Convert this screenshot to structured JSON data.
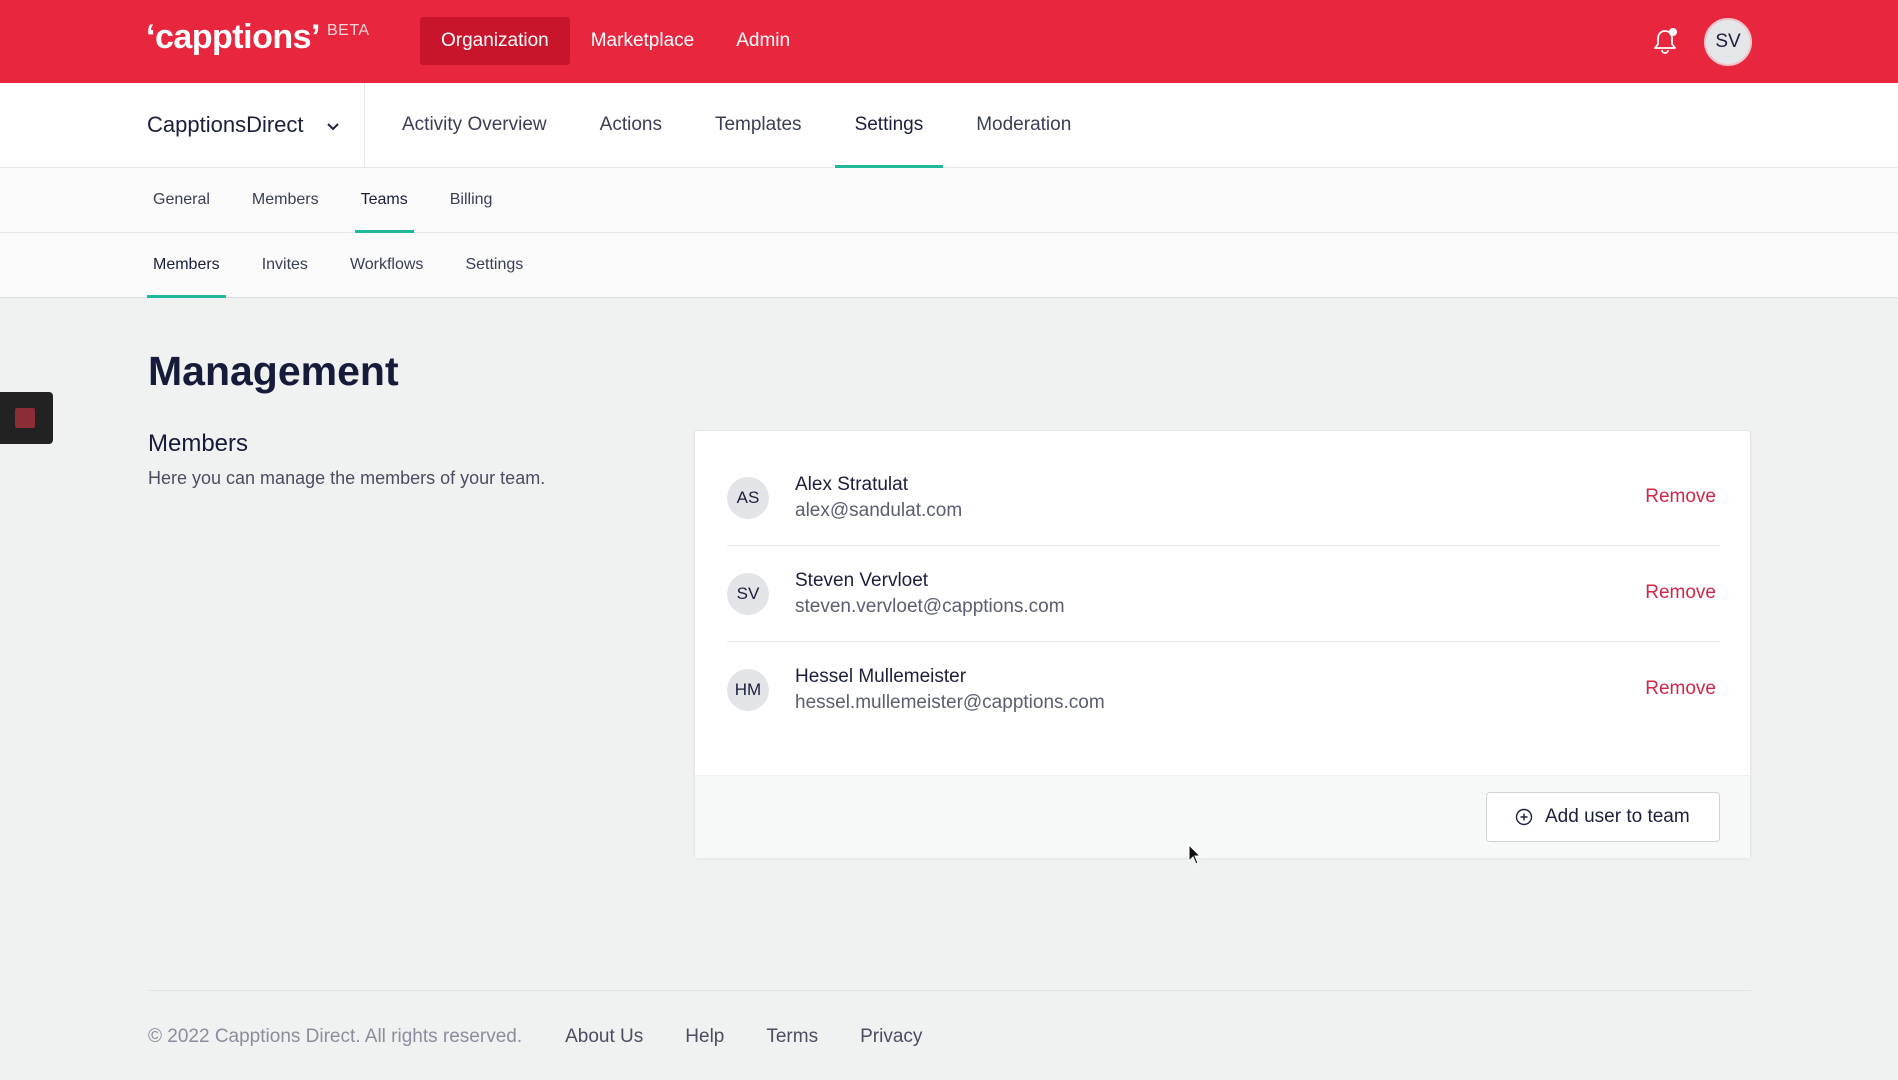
{
  "app": {
    "logo": "‘capptions’",
    "badge": "BETA",
    "top_nav": [
      {
        "label": "Organization",
        "active": true
      },
      {
        "label": "Marketplace",
        "active": false
      },
      {
        "label": "Admin",
        "active": false
      }
    ],
    "user_initials": "SV",
    "icons": {
      "notifications": "bell-icon",
      "org_dropdown": "chevron-down-icon",
      "add": "plus-circle-icon"
    }
  },
  "org": {
    "name": "CapptionsDirect",
    "nav": [
      {
        "label": "Activity Overview"
      },
      {
        "label": "Actions"
      },
      {
        "label": "Templates"
      },
      {
        "label": "Settings",
        "active": true
      },
      {
        "label": "Moderation"
      }
    ]
  },
  "settings_tabs": [
    {
      "label": "General"
    },
    {
      "label": "Members"
    },
    {
      "label": "Teams",
      "active": true
    },
    {
      "label": "Billing"
    }
  ],
  "team_tabs": [
    {
      "label": "Members",
      "active": true
    },
    {
      "label": "Invites"
    },
    {
      "label": "Workflows"
    },
    {
      "label": "Settings"
    }
  ],
  "main": {
    "title": "Management",
    "section_title": "Members",
    "section_desc": "Here you can manage the members of your team.",
    "members": [
      {
        "initials": "AS",
        "name": "Alex Stratulat",
        "email": "alex@sandulat.com",
        "action": "Remove"
      },
      {
        "initials": "SV",
        "name": "Steven Vervloet",
        "email": "steven.vervloet@capptions.com",
        "action": "Remove"
      },
      {
        "initials": "HM",
        "name": "Hessel Mullemeister",
        "email": "hessel.mullemeister@capptions.com",
        "action": "Remove"
      }
    ],
    "add_button": "Add user to team"
  },
  "footer": {
    "copyright": "© 2022 Capptions Direct. All rights reserved.",
    "links": [
      "About Us",
      "Help",
      "Terms",
      "Privacy"
    ]
  },
  "colors": {
    "brand": "#e8273f",
    "accent": "#20b89a",
    "danger": "#d3254a"
  }
}
